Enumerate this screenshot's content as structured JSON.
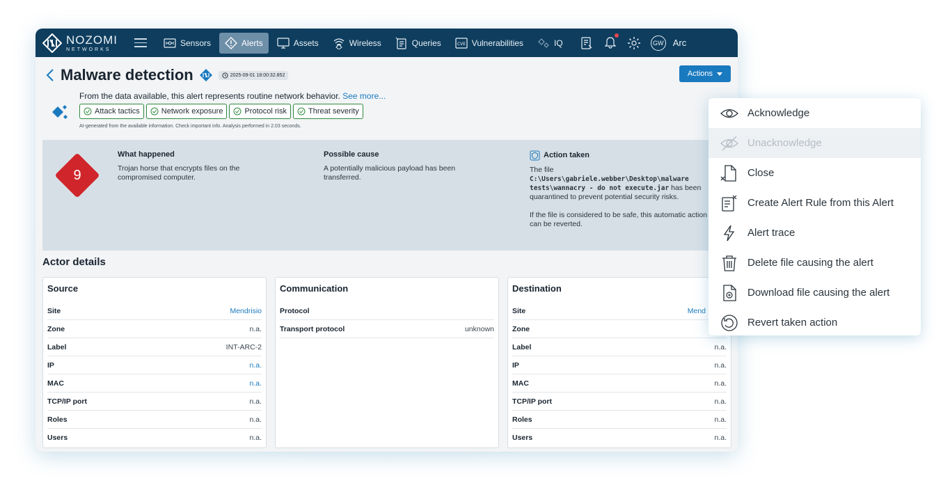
{
  "app": {
    "logo_line1": "NOZOMI",
    "logo_line2": "NETWORKS"
  },
  "nav": {
    "items": [
      {
        "label": "Sensors",
        "icon": "sensor-icon"
      },
      {
        "label": "Alerts",
        "icon": "alert-diamond-icon",
        "active": true
      },
      {
        "label": "Assets",
        "icon": "monitor-icon"
      },
      {
        "label": "Wireless",
        "icon": "wireless-icon"
      },
      {
        "label": "Queries",
        "icon": "queries-icon"
      },
      {
        "label": "Vulnerabilities",
        "icon": "cve-icon"
      },
      {
        "label": "IQ",
        "icon": "iq-icon"
      }
    ],
    "avatar": "GW",
    "user": "Arc"
  },
  "header": {
    "title": "Malware detection",
    "timestamp": "2025-09-01 18:00:32.852",
    "actions_label": "Actions"
  },
  "ai_summary": {
    "text": "From the data available, this alert represents routine network behavior.",
    "see_more": "See more...",
    "chips": [
      "Attack tactics",
      "Network exposure",
      "Protocol risk",
      "Threat severity"
    ],
    "footnote": "AI-generated from the available information. Check important info. Analysis performed in 2.03 seconds."
  },
  "info": {
    "severity": "9",
    "what_happened_title": "What happened",
    "what_happened": "Trojan horse that encrypts files on the compromised computer.",
    "possible_cause_title": "Possible cause",
    "possible_cause": "A potentially malicious payload has been transferred.",
    "action_taken_title": "Action taken",
    "action_prefix": "The file",
    "action_path": "C:\\Users\\gabriele.webber\\Desktop\\malware tests\\wannacry - do not execute.jar",
    "action_suffix": "has been quarantined to prevent potential security risks.",
    "action_note": "If the file is considered to be safe, this automatic action can be reverted."
  },
  "actor": {
    "title": "Actor details",
    "source": {
      "title": "Source",
      "rows": [
        {
          "k": "Site",
          "v": "Mendrisio"
        },
        {
          "k": "Zone",
          "v": "n.a."
        },
        {
          "k": "Label",
          "v": "INT-ARC-2"
        },
        {
          "k": "IP",
          "v": "n.a."
        },
        {
          "k": "MAC",
          "v": "n.a."
        },
        {
          "k": "TCP/IP port",
          "v": "n.a."
        },
        {
          "k": "Roles",
          "v": "n.a."
        },
        {
          "k": "Users",
          "v": "n.a."
        }
      ]
    },
    "communication": {
      "title": "Communication",
      "rows": [
        {
          "k": "Protocol",
          "v": ""
        },
        {
          "k": "Transport protocol",
          "v": "unknown"
        }
      ]
    },
    "destination": {
      "title": "Destination",
      "rows": [
        {
          "k": "Site",
          "v": "Mend"
        },
        {
          "k": "Zone",
          "v": ""
        },
        {
          "k": "Label",
          "v": "n.a."
        },
        {
          "k": "IP",
          "v": "n.a."
        },
        {
          "k": "MAC",
          "v": "n.a."
        },
        {
          "k": "TCP/IP port",
          "v": "n.a."
        },
        {
          "k": "Roles",
          "v": "n.a."
        },
        {
          "k": "Users",
          "v": "n.a."
        }
      ]
    }
  },
  "menu": {
    "items": [
      {
        "label": "Acknowledge",
        "icon": "eye-icon"
      },
      {
        "label": "Unacknowledge",
        "icon": "eye-off-icon",
        "disabled": true
      },
      {
        "label": "Close",
        "icon": "close-file-icon"
      },
      {
        "label": "Create Alert Rule from this Alert",
        "icon": "alert-rule-icon"
      },
      {
        "label": "Alert trace",
        "icon": "lightning-icon"
      },
      {
        "label": "Delete file causing the alert",
        "icon": "trash-icon"
      },
      {
        "label": "Download file causing the alert",
        "icon": "file-download-icon"
      },
      {
        "label": "Revert taken action",
        "icon": "revert-icon"
      }
    ]
  },
  "colors": {
    "topbar": "#0e3d5e",
    "accent": "#1a7abf",
    "severity": "#d0262b",
    "chip_border": "#2d8a3e"
  }
}
